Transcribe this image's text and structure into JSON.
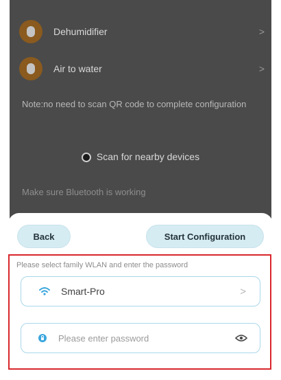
{
  "background": {
    "devices": [
      {
        "label": "Dehumidifier",
        "chevron": ">"
      },
      {
        "label": "Air to water",
        "chevron": ">"
      }
    ],
    "note": "Note:no need to scan QR code to complete configuration",
    "scan_label": "Scan for nearby devices",
    "bluetooth_note": "Make sure Bluetooth is working"
  },
  "sheet": {
    "back_label": "Back",
    "start_label": "Start Configuration",
    "hint": "Please select family WLAN and enter the password",
    "wifi": {
      "ssid": "Smart-Pro",
      "chevron": ">"
    },
    "password": {
      "placeholder": "Please enter password",
      "value": ""
    }
  },
  "colors": {
    "accent": "#a9d7ea",
    "button_bg": "#d6ecf3",
    "highlight_border": "#d8262b",
    "overlay": "#4a4a4a",
    "icon_blue": "#3aa6dd"
  }
}
